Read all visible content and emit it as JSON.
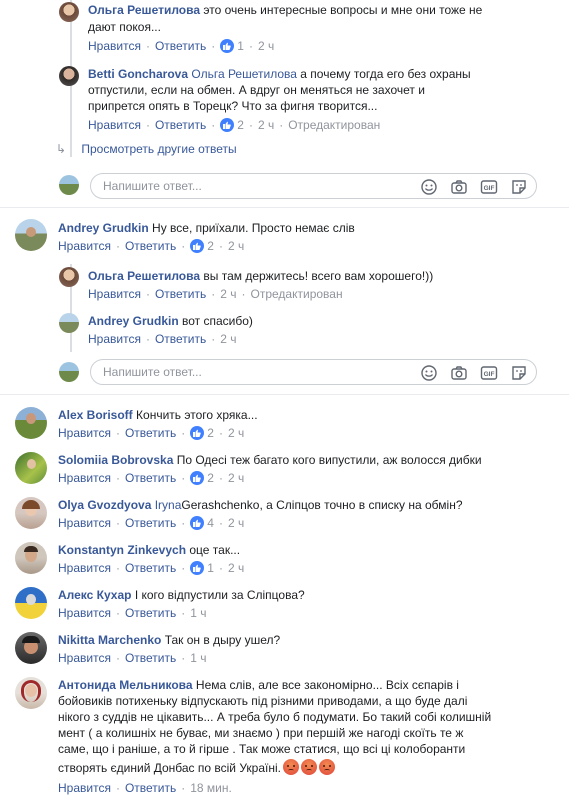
{
  "labels": {
    "like": "Нравится",
    "reply": "Ответить",
    "edited": "Отредактирован",
    "reply_placeholder": "Напишите ответ..."
  },
  "thread1": {
    "c1": {
      "name": "Ольга Решетилова",
      "text1": "это очень интересные вопросы и мне они тоже не",
      "text2": "дают покоя...",
      "likes": "1",
      "time": "2 ч"
    },
    "c2": {
      "name": "Betti Goncharova",
      "mention": "Ольга Решетилова",
      "text1": "а почему тогда его без охраны",
      "text2": "отпустили, если на обмен. А вдруг он меняться не захочет и",
      "text3": "припрется опять в Торецк? Что за фигня творится...",
      "likes": "2",
      "time": "2 ч"
    },
    "more_replies": "Просмотреть другие ответы"
  },
  "thread2": {
    "main": {
      "name": "Andrey Grudkin",
      "text": "Ну все, приїхали. Просто немає слів",
      "likes": "2",
      "time": "2 ч"
    },
    "r1": {
      "name": "Ольга Решетилова",
      "text": "вы там держитесь! всего вам хорошего!))",
      "time": "2 ч"
    },
    "r2": {
      "name": "Andrey Grudkin",
      "text": "вот спасибо)",
      "time": "2 ч"
    }
  },
  "comments": [
    {
      "name": "Alex Borisoff",
      "text": "Кончить этого хряка...",
      "likes": "2",
      "time": "2 ч"
    },
    {
      "name": "Solomiia Bobrovska",
      "text": "По Одесі теж багато кого випустили, аж волосся дибки",
      "likes": "2",
      "time": "2 ч"
    },
    {
      "name": "Olya Gvozdyova",
      "mention": "Iryna",
      "text": "Gerashchenko, а Сліпцов точно в списку на обмін?",
      "likes": "4",
      "time": "2 ч"
    },
    {
      "name": "Konstantyn Zinkevych",
      "text": "оце так...",
      "likes": "1",
      "time": "2 ч"
    },
    {
      "name": "Алекс Кухар",
      "text": "І кого відпустили за Сліпцова?",
      "time": "1 ч"
    },
    {
      "name": "Nikitta Marchenko",
      "text": "Так он в дыру ушел?",
      "time": "1 ч"
    }
  ],
  "last": {
    "name": "Антонида Мельникова",
    "t1": "Нема слів, але все закономірно... Всіх сєпарів і",
    "t2": "бойовиків потихеньку відпускають під різними приводами, а що буде далі",
    "t3": "нікого з суддів не цікавить... А треба було б подумати. Бо такий собі колишній",
    "t4": "мент ( а колишніх не буває, ми знаємо ) при першій же нагоді скоїть те ж",
    "t5": "саме, що і раніше, а то й гірше . Так може статися, що всі ці колоборанти",
    "t6": "створять єдиний Донбас по всій Україні.",
    "time": "18 мин."
  },
  "colors": {
    "link": "#385898",
    "meta": "#90949c",
    "like_blue": "#4080ff",
    "border": "#ccd0d5"
  }
}
